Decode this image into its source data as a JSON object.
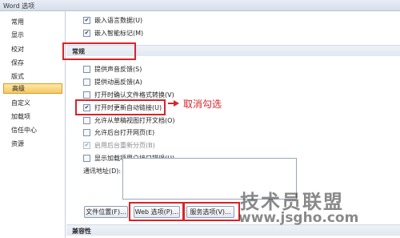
{
  "window": {
    "title": "Word 选项"
  },
  "sidebar": {
    "items": [
      {
        "label": "常用"
      },
      {
        "label": "显示"
      },
      {
        "label": "校对"
      },
      {
        "label": "保存"
      },
      {
        "label": "版式"
      },
      {
        "label": "高级",
        "active": true
      },
      {
        "label": "自定义"
      },
      {
        "label": "加载项"
      },
      {
        "label": "信任中心"
      },
      {
        "label": "资源"
      }
    ]
  },
  "top_options": [
    {
      "label": "嵌入语言数据(U)",
      "checked": true
    },
    {
      "label": "嵌入智能标记(M)",
      "checked": true
    }
  ],
  "general": {
    "heading": "常规",
    "options": [
      {
        "label": "提供声音反馈(S)",
        "checked": false,
        "disabled": false
      },
      {
        "label": "提供动画反馈(A)",
        "checked": false,
        "disabled": false
      },
      {
        "label": "打开时确认文件格式转换(V)",
        "checked": false,
        "disabled": false
      },
      {
        "label": "打开时更新自动链接(U)",
        "checked": true,
        "disabled": false
      },
      {
        "label": "允许从草稿视图打开文档(O)",
        "checked": false,
        "disabled": false
      },
      {
        "label": "允许后台打开网页(E)",
        "checked": false,
        "disabled": false
      },
      {
        "label": "启用后台重新分页(B)",
        "checked": true,
        "disabled": true
      },
      {
        "label": "显示加载项用户接口错误(U)",
        "checked": false,
        "disabled": false
      }
    ],
    "mailing_address_label": "通讯地址(D):",
    "mailing_address_value": "",
    "buttons": {
      "file_locations": "文件位置(F)...",
      "web_options": "Web 选项(P)...",
      "service_options": "服务选项(V)..."
    }
  },
  "compat": {
    "heading": "兼容性"
  },
  "annotation": {
    "text": "取消勾选"
  },
  "watermark": {
    "main": "技术员联盟",
    "url": "www.jsgho.com"
  },
  "colors": {
    "annotation_red": "#d9232a",
    "selected_tab": "#f7c864"
  }
}
